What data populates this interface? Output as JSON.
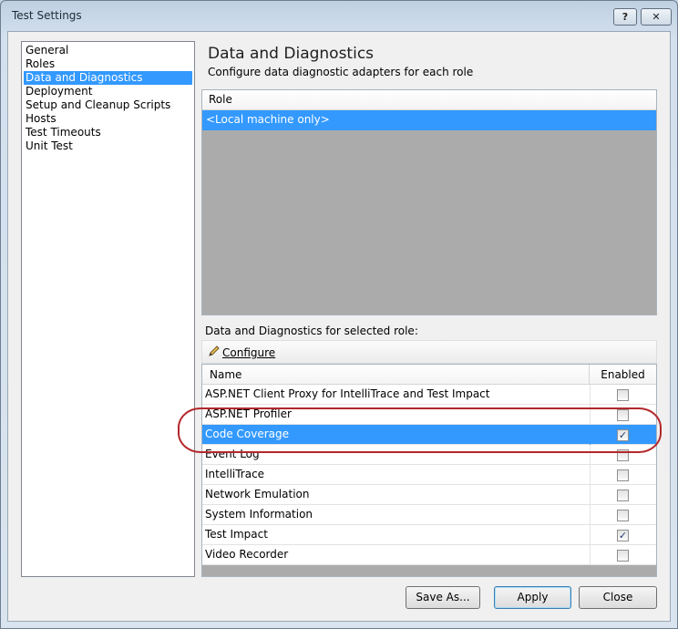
{
  "window": {
    "title": "Test Settings",
    "help_label": "?",
    "close_label": "✕"
  },
  "nav": {
    "items": [
      {
        "label": "General"
      },
      {
        "label": "Roles"
      },
      {
        "label": "Data and Diagnostics",
        "selected": true
      },
      {
        "label": "Deployment"
      },
      {
        "label": "Setup and Cleanup Scripts"
      },
      {
        "label": "Hosts"
      },
      {
        "label": "Test Timeouts"
      },
      {
        "label": "Unit Test"
      }
    ]
  },
  "header": {
    "title": "Data and Diagnostics",
    "subtitle": "Configure data diagnostic adapters for each role"
  },
  "roles": {
    "column": "Role",
    "rows": [
      "<Local machine only>"
    ]
  },
  "adapters_section": {
    "label": "Data and Diagnostics for selected role:",
    "configure_label": "Configure",
    "columns": {
      "name": "Name",
      "enabled": "Enabled"
    },
    "rows": [
      {
        "name": "ASP.NET Client Proxy for IntelliTrace and Test Impact",
        "enabled": false
      },
      {
        "name": "ASP.NET Profiler",
        "enabled": false
      },
      {
        "name": "Code Coverage",
        "enabled": true,
        "selected": true
      },
      {
        "name": "Event Log",
        "enabled": false
      },
      {
        "name": "IntelliTrace",
        "enabled": false
      },
      {
        "name": "Network Emulation",
        "enabled": false
      },
      {
        "name": "System Information",
        "enabled": false
      },
      {
        "name": "Test Impact",
        "enabled": true
      },
      {
        "name": "Video Recorder",
        "enabled": false
      }
    ]
  },
  "buttons": {
    "save_as": "Save As...",
    "apply": "Apply",
    "close": "Close"
  },
  "colors": {
    "selection": "#3399ff",
    "annotation": "#b3272c"
  }
}
